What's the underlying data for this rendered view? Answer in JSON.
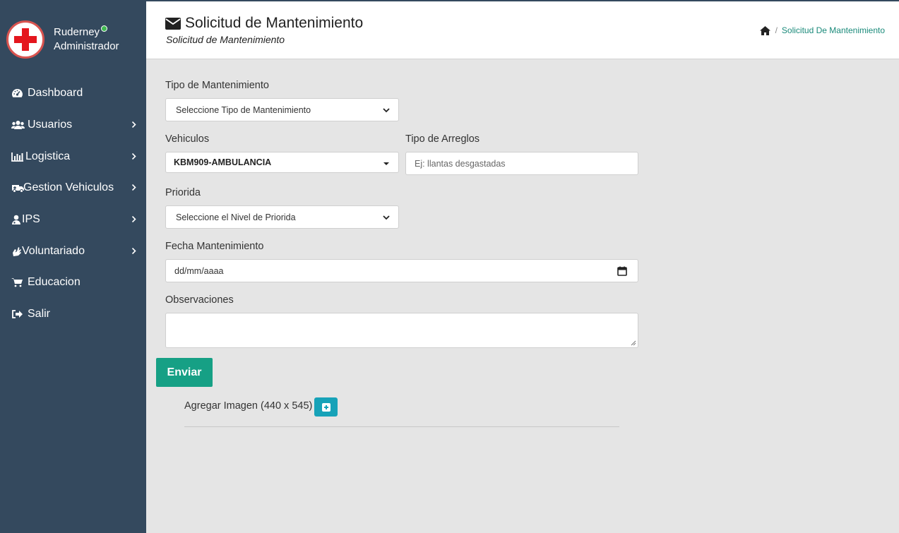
{
  "user": {
    "name": "Ruderney",
    "role": "Administrador"
  },
  "sidebar": {
    "items": [
      {
        "label": "Dashboard",
        "icon": "dashboard-icon",
        "has_submenu": false
      },
      {
        "label": "Usuarios",
        "icon": "users-icon",
        "has_submenu": true
      },
      {
        "label": "Logistica",
        "icon": "bar-chart-icon",
        "has_submenu": true
      },
      {
        "label": "Gestion Vehiculos",
        "icon": "ambulance-icon",
        "has_submenu": true
      },
      {
        "label": "IPS",
        "icon": "user-doctor-icon",
        "has_submenu": true
      },
      {
        "label": "Voluntariado",
        "icon": "hands-icon",
        "has_submenu": true
      },
      {
        "label": "Educacion",
        "icon": "cart-icon",
        "has_submenu": false
      },
      {
        "label": "Salir",
        "icon": "sign-out-icon",
        "has_submenu": false
      }
    ]
  },
  "header": {
    "title": "Solicitud de Mantenimiento",
    "subtitle": "Solicitud de Mantenimiento",
    "breadcrumb": {
      "home_icon": "home-icon",
      "separator": "/",
      "current": "Solicitud De Mantenimiento"
    }
  },
  "form": {
    "tipo_mantenimiento": {
      "label": "Tipo de Mantenimiento",
      "value": "Seleccione Tipo de Mantenimiento"
    },
    "vehiculos": {
      "label": "Vehiculos",
      "value": "KBM909-AMBULANCIA"
    },
    "tipo_arreglos": {
      "label": "Tipo de Arreglos",
      "placeholder": "Ej: llantas desgastadas"
    },
    "prioridad": {
      "label": "Priorida",
      "value": "Seleccione el Nivel de Priorida"
    },
    "fecha": {
      "label": "Fecha Mantenimiento",
      "value": "dd/mm/aaaa"
    },
    "observaciones": {
      "label": "Observaciones",
      "value": ""
    },
    "submit_label": "Enviar",
    "image_label": "Agregar Imagen (440 x 545)"
  },
  "colors": {
    "sidebar": "#34495e",
    "accent": "#16a085",
    "info": "#17a2b8",
    "link": "#1a8a7a"
  }
}
